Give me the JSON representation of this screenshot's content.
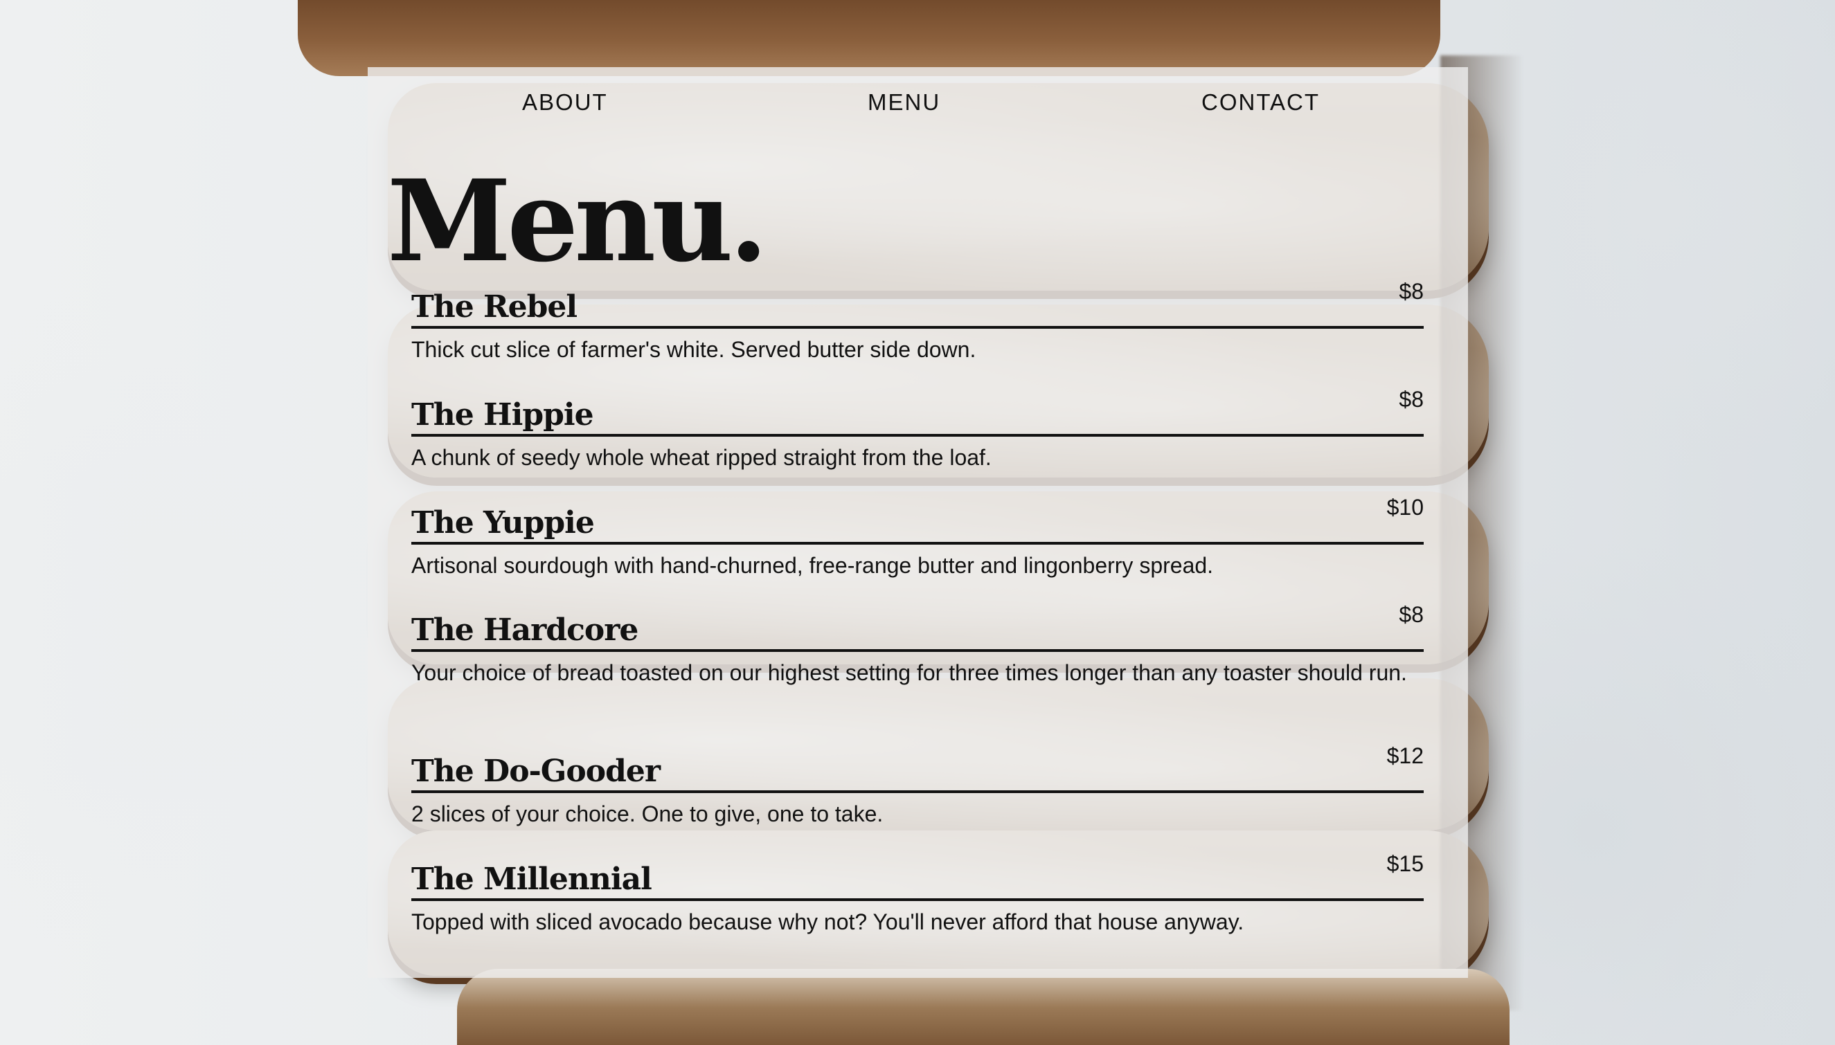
{
  "nav": {
    "about": "ABOUT",
    "menu": "MENU",
    "contact": "CONTACT"
  },
  "title": "Menu.",
  "items": [
    {
      "name": "The Rebel",
      "price": "$8",
      "description": "Thick cut slice of farmer's white. Served butter side down."
    },
    {
      "name": "The Hippie",
      "price": "$8",
      "description": "A chunk of seedy whole wheat ripped straight from the loaf."
    },
    {
      "name": "The Yuppie",
      "price": "$10",
      "description": "Artisonal sourdough with hand-churned, free-range butter and lingonberry spread."
    },
    {
      "name": "The Hardcore",
      "price": "$8",
      "description": "Your choice of bread toasted on our highest setting for three times longer than any toaster should run."
    },
    {
      "name": "The Do-Gooder",
      "price": "$12",
      "description": "2 slices of your choice. One to give, one to take."
    },
    {
      "name": "The Millennial",
      "price": "$15",
      "description": "Topped with sliced avocado because why not? You'll never afford that house anyway."
    }
  ],
  "colors": {
    "text": "#111111",
    "panel": "rgba(238,238,238,0.82)",
    "crust": "#6b4427"
  }
}
